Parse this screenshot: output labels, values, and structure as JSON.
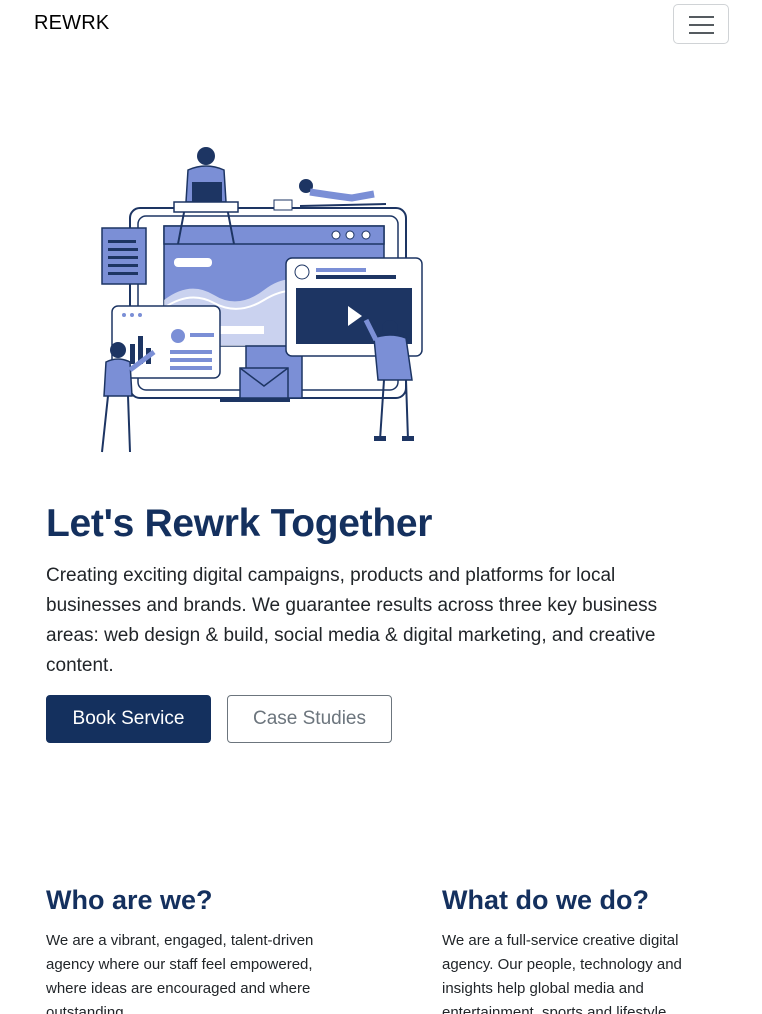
{
  "navbar": {
    "brand": "REWRK",
    "toggler_icon": "hamburger-menu-icon"
  },
  "hero": {
    "illustration": "digital-agency-illustration",
    "title": "Let's Rewrk Together",
    "description": "Creating exciting digital campaigns, products and platforms for local businesses and brands. We guarantee results across three key business areas: web design & build, social media & digital marketing, and creative content.",
    "primary_button": "Book Service",
    "secondary_button": "Case Studies"
  },
  "about": {
    "who": {
      "title": "Who are we?",
      "text": "We are a vibrant, engaged, talent-driven agency where our staff feel empowered, where ideas are encouraged and where outstanding"
    },
    "what": {
      "title": "What do we do?",
      "text": "We are a full-service creative digital agency. Our people, technology and insights help global media and entertainment, sports and lifestyle"
    }
  },
  "colors": {
    "brand_navy": "#14305e",
    "illustration_blue": "#7b8fd6",
    "text": "#212529",
    "muted": "#6c757d"
  }
}
